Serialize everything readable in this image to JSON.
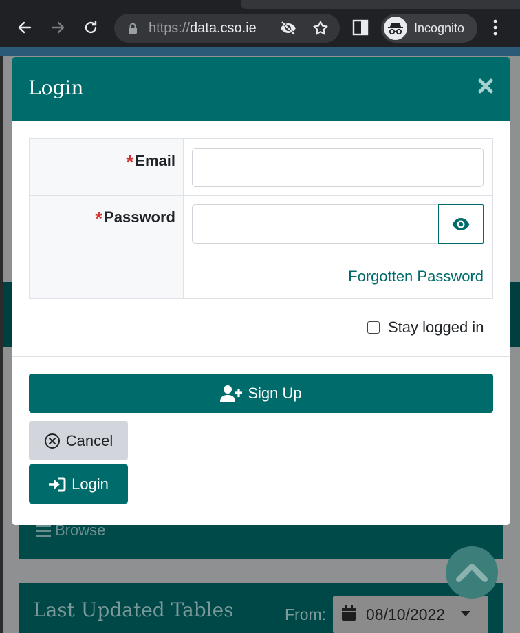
{
  "browser": {
    "url_scheme": "https://",
    "url_host": "data.cso.ie",
    "profile_label": "Incognito"
  },
  "background_page": {
    "browse_label": "Browse",
    "last_updated_title": "Last Updated Tables",
    "from_label": "From:",
    "from_date": "08/10/2022"
  },
  "modal": {
    "title": "Login",
    "fields": {
      "email_label": "Email",
      "email_value": "",
      "password_label": "Password",
      "password_value": "",
      "required_marker": "*"
    },
    "forgotten_password": "Forgotten Password",
    "stay_logged_in": "Stay logged in",
    "stay_logged_in_checked": false,
    "buttons": {
      "sign_up": "Sign Up",
      "cancel": "Cancel",
      "login": "Login"
    }
  },
  "colors": {
    "primary": "#006b6b",
    "required": "#d0342c",
    "secondary_button": "#d2d6dc"
  },
  "icons": {
    "close": "close-icon",
    "show_password": "eye-icon",
    "sign_up": "user-plus-icon",
    "cancel": "circle-x-icon",
    "login": "sign-in-icon"
  }
}
